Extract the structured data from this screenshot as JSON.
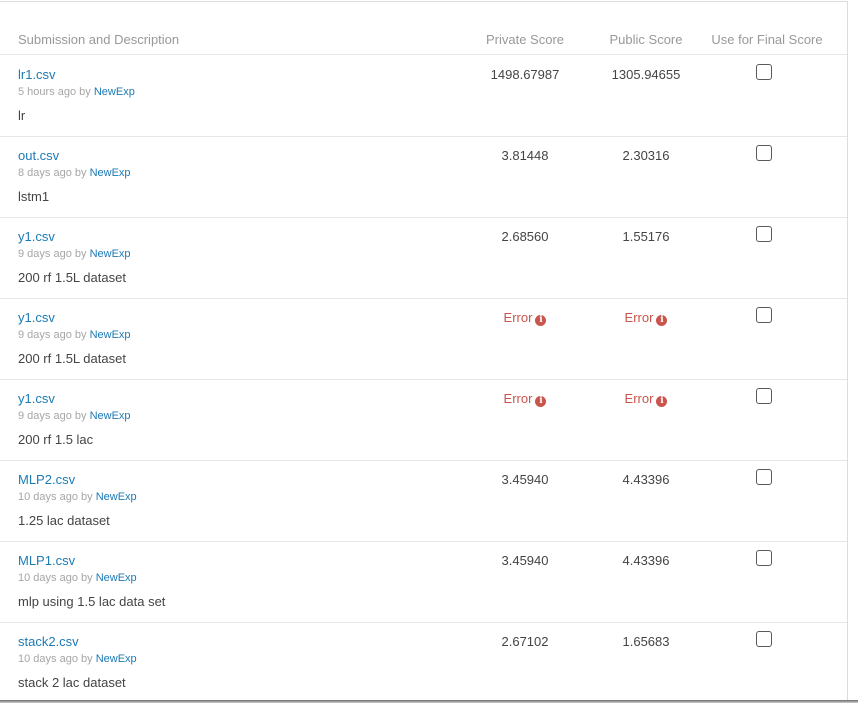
{
  "header": {
    "description": "Submission and Description",
    "private": "Private Score",
    "public": "Public Score",
    "final": "Use for Final Score"
  },
  "rows": [
    {
      "file": "lr1.csv",
      "time": "5 hours ago",
      "by": "by",
      "user": "NewExp",
      "desc": "lr",
      "private": "1498.67987",
      "public": "1305.94655",
      "checked": false
    },
    {
      "file": "out.csv",
      "time": "8 days ago",
      "by": "by",
      "user": "NewExp",
      "desc": "lstm1",
      "private": "3.81448",
      "public": "2.30316",
      "checked": false
    },
    {
      "file": "y1.csv",
      "time": "9 days ago",
      "by": "by",
      "user": "NewExp",
      "desc": "200 rf 1.5L dataset",
      "private": "2.68560",
      "public": "1.55176",
      "checked": false
    },
    {
      "file": "y1.csv",
      "time": "9 days ago",
      "by": "by",
      "user": "NewExp",
      "desc": "200 rf 1.5L dataset",
      "private": "Error",
      "public": "Error",
      "checked": false
    },
    {
      "file": "y1.csv",
      "time": "9 days ago",
      "by": "by",
      "user": "NewExp",
      "desc": "200 rf 1.5 lac",
      "private": "Error",
      "public": "Error",
      "checked": false
    },
    {
      "file": "MLP2.csv",
      "time": "10 days ago",
      "by": "by",
      "user": "NewExp",
      "desc": "1.25 lac dataset",
      "private": "3.45940",
      "public": "4.43396",
      "checked": false
    },
    {
      "file": "MLP1.csv",
      "time": "10 days ago",
      "by": "by",
      "user": "NewExp",
      "desc": "mlp using 1.5 lac data set",
      "private": "3.45940",
      "public": "4.43396",
      "checked": false
    },
    {
      "file": "stack2.csv",
      "time": "10 days ago",
      "by": "by",
      "user": "NewExp",
      "desc": "stack 2 lac dataset",
      "private": "2.67102",
      "public": "1.65683",
      "checked": false
    }
  ],
  "icons": {
    "error_info": "info-circle-icon"
  },
  "colors": {
    "link": "#1c7ab5",
    "error": "#c9554c",
    "muted": "#999999"
  }
}
